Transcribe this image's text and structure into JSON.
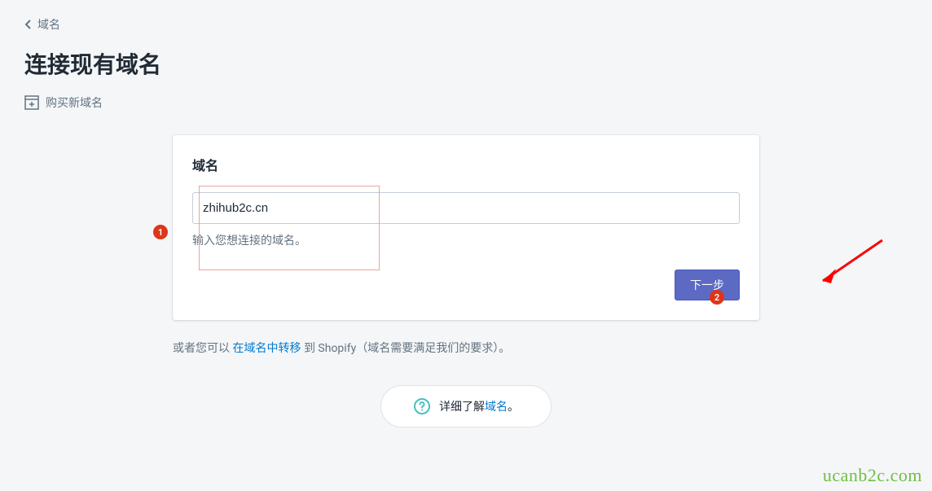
{
  "breadcrumb": {
    "label": "域名"
  },
  "page_title": "连接现有域名",
  "buy_new_domain_label": "购买新域名",
  "card": {
    "title": "域名",
    "domain_value": "zhihub2c.cn",
    "helper": "输入您想连接的域名。",
    "next_button": "下一步"
  },
  "transfer_text": {
    "prefix": "或者您可以 ",
    "link": "在域名中转移",
    "suffix": " 到 Shopify（域名需要满足我们的要求）。"
  },
  "info_pill": {
    "prefix": "详细了解 ",
    "link": "域名",
    "suffix": "。"
  },
  "annotations": {
    "badge1": "1",
    "badge2": "2"
  },
  "watermark": "ucanb2c.com"
}
